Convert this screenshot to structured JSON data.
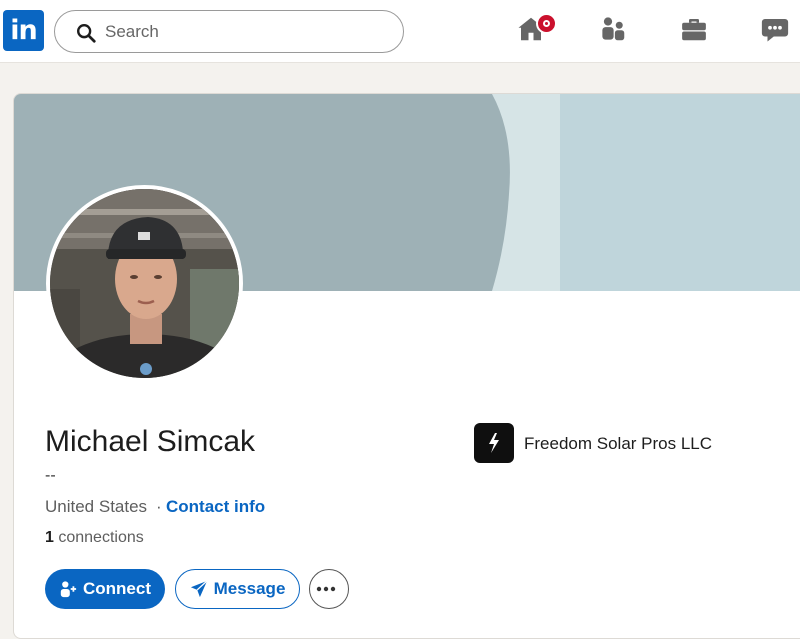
{
  "header": {
    "logo_text": "in",
    "search": {
      "placeholder": "Search",
      "value": ""
    },
    "nav_icons": [
      "home-icon",
      "my-network-icon",
      "jobs-icon",
      "messaging-icon"
    ],
    "notification_badge": true
  },
  "profile": {
    "name": "Michael Simcak",
    "headline": "--",
    "location": "United States",
    "separator": "·",
    "contact_label": "Contact info",
    "connections_count": "1",
    "connections_label": "connections",
    "company": {
      "name": "Freedom Solar Pros LLC",
      "icon": "freedom-solar-logo"
    }
  },
  "actions": {
    "connect_label": "Connect",
    "message_label": "Message",
    "more_icon": "ellipsis-icon"
  },
  "colors": {
    "brand": "#0a66c2",
    "banner_dark": "#9eb1b6",
    "banner_light": "#bfd5db",
    "badge": "#cb112d"
  }
}
